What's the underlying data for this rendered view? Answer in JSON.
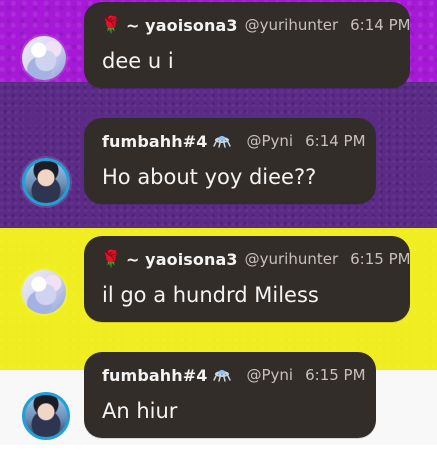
{
  "messages": [
    {
      "name": "~ yaoisona3",
      "handle": "@yurihunter",
      "time": "6:14 PM",
      "text": "dee u i",
      "badge_icon": "rose-icon"
    },
    {
      "name": "fumbahh#4",
      "handle": "@Pyni",
      "time": "6:14 PM",
      "text": "Ho about yoy diee??",
      "badge_icon": "ufo-icon"
    },
    {
      "name": "~ yaoisona3",
      "handle": "@yurihunter",
      "time": "6:15 PM",
      "text": "il go a hundrd Miless",
      "badge_icon": "rose-icon"
    },
    {
      "name": "fumbahh#4",
      "handle": "@Pyni",
      "time": "6:15 PM",
      "text": "An hiur",
      "badge_icon": "ufo-icon"
    }
  ],
  "colors": {
    "bubble": "#322d29",
    "band_1": "#a61ad7",
    "band_2": "#5b2b87",
    "band_3": "#f0ee20",
    "band_4": "#f8f8f8"
  }
}
